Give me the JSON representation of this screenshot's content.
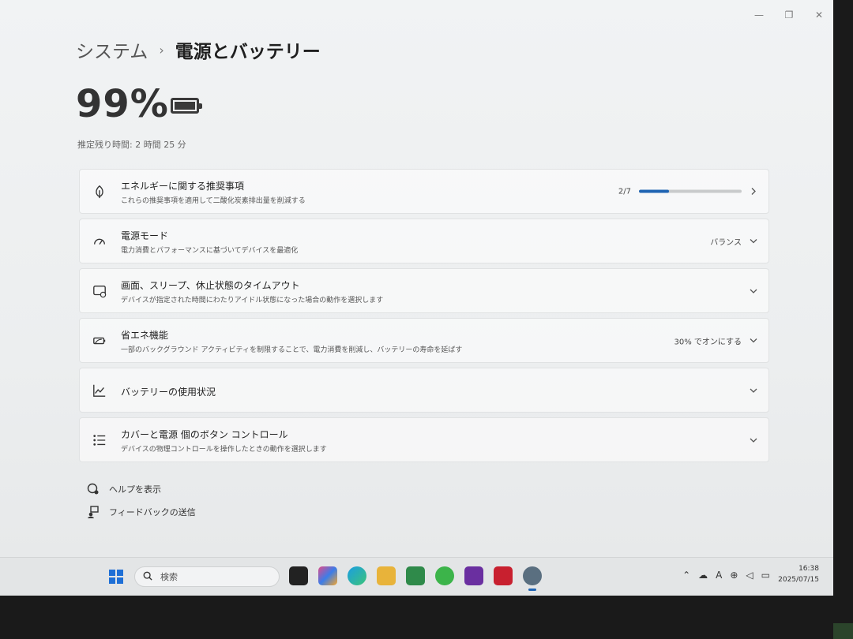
{
  "breadcrumb": {
    "parent": "システム",
    "separator": "›",
    "current": "電源とバッテリー"
  },
  "battery": {
    "percent": "99%",
    "remaining": "推定残り時間: 2 時間 25 分"
  },
  "cards": [
    {
      "title": "エネルギーに関する推奨事項",
      "subtitle": "これらの推奨事項を適用して二酸化炭素排出量を削減する",
      "value": "2/7",
      "progress": 0.29
    },
    {
      "title": "電源モード",
      "subtitle": "電力消費とパフォーマンスに基づいてデバイスを最適化",
      "value": "バランス"
    },
    {
      "title": "画面、スリープ、休止状態のタイムアウト",
      "subtitle": "デバイスが指定された時間にわたりアイドル状態になった場合の動作を選択します"
    },
    {
      "title": "省エネ機能",
      "subtitle": "一部のバックグラウンド アクティビティを制限することで、電力消費を削減し、バッテリーの寿命を延ばす",
      "value": "30% でオンにする"
    },
    {
      "title": "バッテリーの使用状況"
    },
    {
      "title": "カバーと電源 個のボタン コントロール",
      "subtitle": "デバイスの物理コントロールを操作したときの動作を選択します"
    }
  ],
  "links": {
    "help": "ヘルプを表示",
    "feedback": "フィードバックの送信"
  },
  "taskbar": {
    "search_placeholder": "検索",
    "time": "16:38",
    "date": "2025/07/15",
    "ime": "A"
  },
  "colors": {
    "accent": "#1f64b3",
    "start": "#1e6fd6"
  }
}
